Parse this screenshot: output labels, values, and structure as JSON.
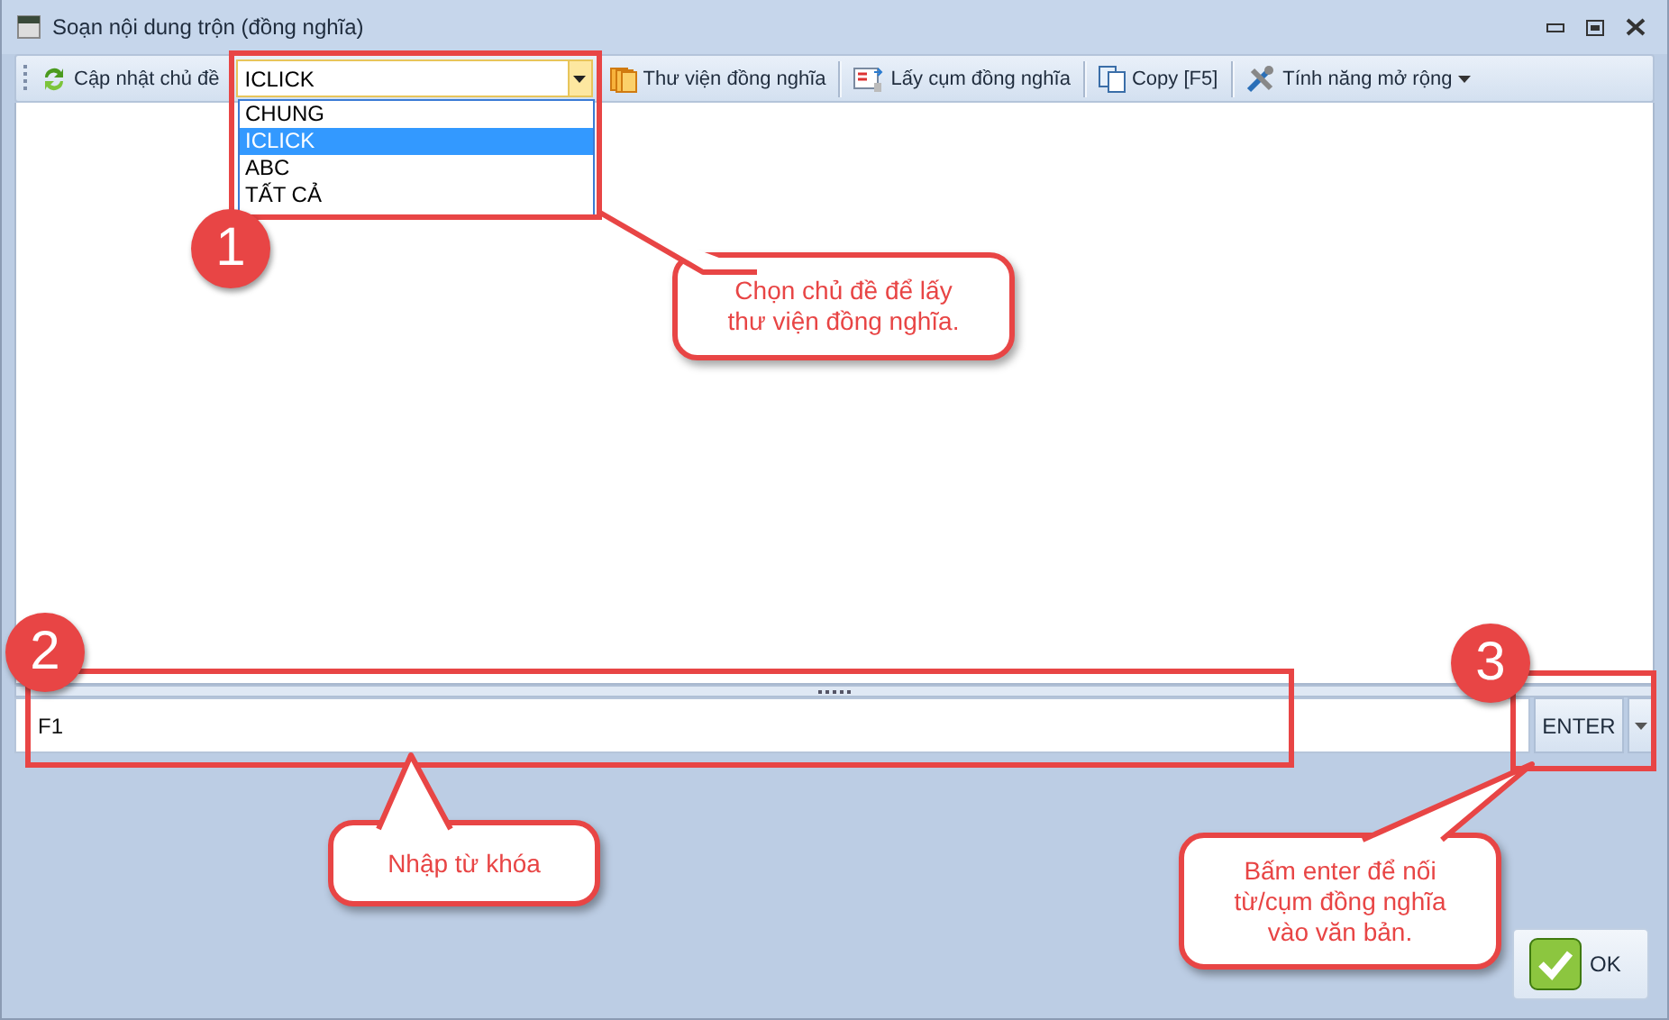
{
  "window": {
    "title": "Soạn nội dung trộn (đồng nghĩa)"
  },
  "toolbar": {
    "items": [
      {
        "kind": "button",
        "label": "Cập nhật chủ đề"
      },
      {
        "kind": "combo",
        "value": "ICLICK",
        "expanded": true
      },
      {
        "kind": "button",
        "label": "Thư viện đồng nghĩa"
      },
      {
        "kind": "button",
        "label": "Lấy cụm đồng nghĩa"
      },
      {
        "kind": "button",
        "label": "Copy [F5]"
      },
      {
        "kind": "menu",
        "label": "Tính năng mở rộng"
      }
    ]
  },
  "dropdown": {
    "options": [
      {
        "label": "CHUNG",
        "selected": false
      },
      {
        "label": "ICLICK",
        "selected": true
      },
      {
        "label": "ABC",
        "selected": false
      },
      {
        "label": "TẤT CẢ",
        "selected": false
      }
    ]
  },
  "keyword_field": {
    "value": "F1"
  },
  "enter_button": {
    "label": "ENTER"
  },
  "ok_button": {
    "label": "OK"
  },
  "annotations": [
    {
      "number": "1",
      "text": "Chọn chủ đề để lấy\nthư viện đồng nghĩa."
    },
    {
      "number": "2",
      "text": "Nhập từ khóa"
    },
    {
      "number": "3",
      "text": "Bấm enter để nối\ntừ/cụm đồng nghĩa\nvào văn bản."
    }
  ]
}
